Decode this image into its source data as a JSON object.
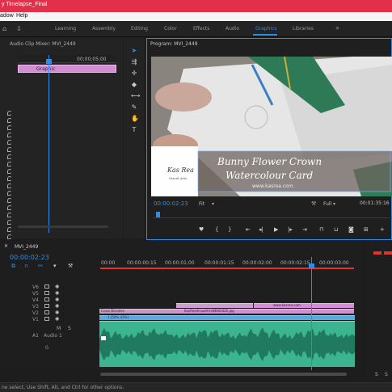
{
  "title_bar": {
    "text": "y Timelapse_Final"
  },
  "menu": {
    "items": [
      "adow",
      "Help"
    ]
  },
  "workspaces": {
    "items": [
      "Learning",
      "Assembly",
      "Editing",
      "Color",
      "Effects",
      "Audio",
      "Graphics",
      "Libraries"
    ],
    "active": "Graphics",
    "more": "»"
  },
  "mixer": {
    "tab": "Audio Clip Mixer: MVI_2449",
    "timecode": "00;00;05;00",
    "clip_label": "Graphic"
  },
  "program": {
    "tab": "Program: MVI_2449",
    "timecode": "00:00:02:23",
    "fit": "Fit",
    "full": "Full",
    "duration": "00:01:35:16",
    "overlay": {
      "logo_line1": "Kas Rea",
      "logo_line2": "Visual Arts",
      "title1": "Bunny Flower Crown",
      "title2": "Watercolour Card",
      "url": "www.kasrea.com"
    }
  },
  "timeline": {
    "tab": "MVI_2449",
    "timecode": "00:00:02:23",
    "ruler": [
      "00:00",
      "00:00:00:15",
      "00:00:01:00",
      "00:00:01:15",
      "00:00:02:00",
      "00:00:02:15",
      "00:00:03:00"
    ],
    "tracks": [
      "V6",
      "V5",
      "V4",
      "V3",
      "V2",
      "V1",
      "A1"
    ],
    "a1_name": "Audio 1",
    "a1_level": "0.",
    "clips": {
      "v3": "www.kasrea.com",
      "v2": "KasReaVisualArtsNEW2020.jpg",
      "v2_left": "Cross Dissolve",
      "v1": "1.[50% 43%]"
    }
  },
  "meters": {
    "labels": [
      "S",
      "S"
    ]
  },
  "status": {
    "text": "ne select. Use Shift, Alt, and Ctrl for other options."
  },
  "colors": {
    "accent": "#2d8ceb",
    "title_bar": "#e3304a",
    "graphic_clip": "#d38fd3",
    "audio_clip": "#3bb48f",
    "video_clip": "#5aa9e6"
  }
}
